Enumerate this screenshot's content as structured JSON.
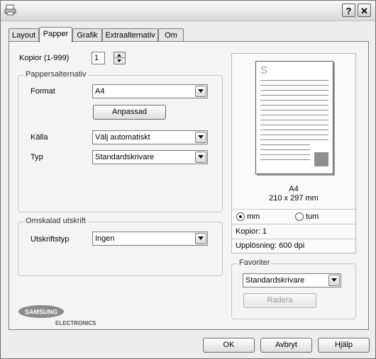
{
  "titlebar": {
    "help_label": "?",
    "close_label": "✕"
  },
  "tabs": [
    {
      "label": "Layout"
    },
    {
      "label": "Papper"
    },
    {
      "label": "Grafik"
    },
    {
      "label": "Extraalternativ"
    },
    {
      "label": "Om"
    }
  ],
  "copies": {
    "label": "Kopior (1-999)",
    "value": "1"
  },
  "paper_options": {
    "legend": "Pappersalternativ",
    "format_label": "Format",
    "format_value": "A4",
    "custom_button": "Anpassad",
    "source_label": "Källa",
    "source_value": "Välj automatiskt",
    "type_label": "Typ",
    "type_value": "Standardskrivare"
  },
  "scaled_print": {
    "legend": "Omskalad utskrift",
    "print_type_label": "Utskriftstyp",
    "print_type_value": "Ingen"
  },
  "preview": {
    "page_letter": "S",
    "paper_name": "A4",
    "paper_size": "210 x 297 mm",
    "unit_mm": "mm",
    "unit_inch": "tum",
    "copies_text": "Kopior: 1",
    "resolution_text": "Upplösning: 600 dpi"
  },
  "favorites": {
    "legend": "Favoriter",
    "value": "Standardskrivare",
    "delete_button": "Radera"
  },
  "logo": {
    "brand": "SAMSUNG",
    "sub": "ELECTRONICS"
  },
  "footer": {
    "ok": "OK",
    "cancel": "Avbryt",
    "help": "Hjälp"
  }
}
